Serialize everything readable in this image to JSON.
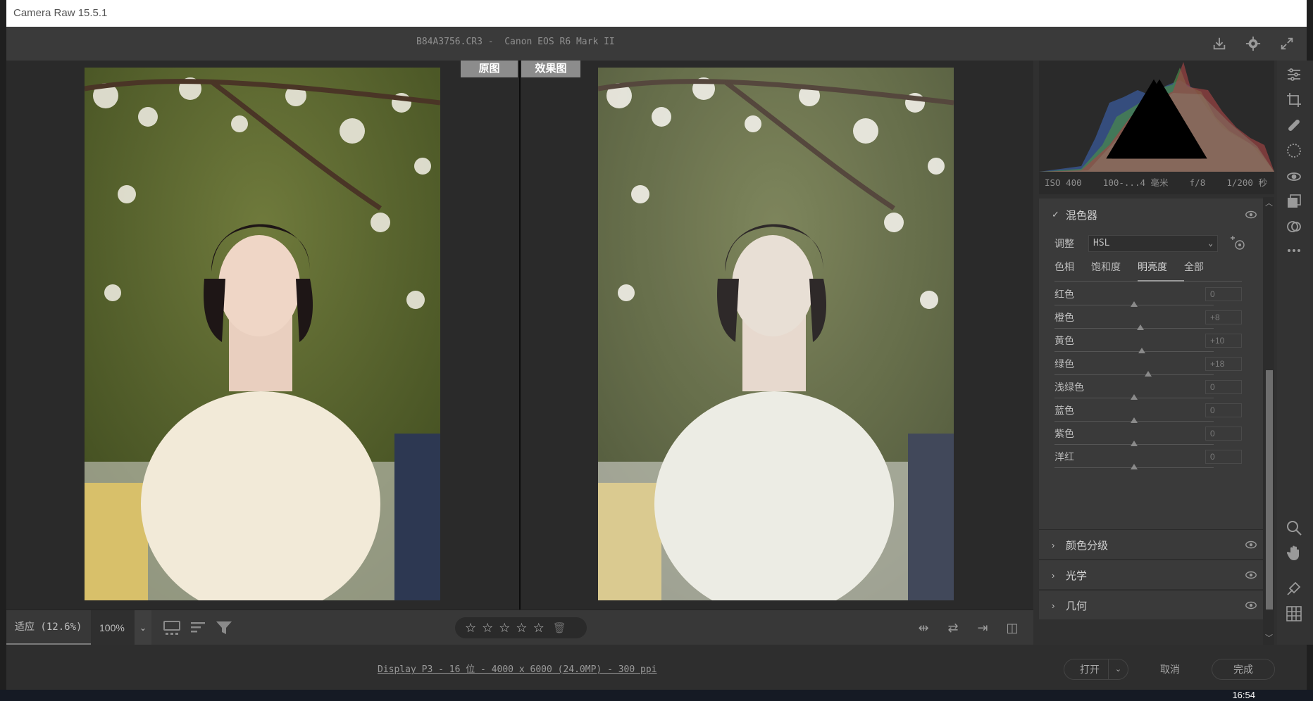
{
  "window": {
    "title": "Camera Raw 15.5.1"
  },
  "header": {
    "file_info": "B84A3756.CR3 -  Canon EOS R6 Mark II",
    "icons": [
      "save-icon",
      "settings-gear-icon",
      "fullscreen-icon"
    ]
  },
  "viewer": {
    "before_label": "原图",
    "after_label": "效果图"
  },
  "bottombar": {
    "fit_label": "适应 (12.6%)",
    "zoom_label": "100%",
    "stars": [
      "☆",
      "☆",
      "☆",
      "☆",
      "☆"
    ],
    "rating": 0
  },
  "histogram": {
    "exif": {
      "iso": "ISO 400",
      "lens": "100-...4 毫米",
      "aperture": "f/8",
      "shutter": "1/200 秒"
    }
  },
  "mixer": {
    "title": "混色器",
    "adjust_label": "调整",
    "adjust_value": "HSL",
    "tabs": [
      "色相",
      "饱和度",
      "明亮度",
      "全部"
    ],
    "active_tab": "明亮度",
    "sliders": [
      {
        "label": "红色",
        "value": "0",
        "level": 0.5
      },
      {
        "label": "橙色",
        "value": "+8",
        "level": 0.54
      },
      {
        "label": "黄色",
        "value": "+10",
        "level": 0.55
      },
      {
        "label": "绿色",
        "value": "+18",
        "level": 0.59
      },
      {
        "label": "浅绿色",
        "value": "0",
        "level": 0.5
      },
      {
        "label": "蓝色",
        "value": "0",
        "level": 0.5
      },
      {
        "label": "紫色",
        "value": "0",
        "level": 0.5
      },
      {
        "label": "洋红",
        "value": "0",
        "level": 0.5
      }
    ]
  },
  "sections": [
    {
      "title": "颜色分级"
    },
    {
      "title": "光学"
    },
    {
      "title": "几何"
    }
  ],
  "footer": {
    "info": "Display P3 - 16 位 - 4000 x 6000 (24.0MP) - 300 ppi",
    "open_label": "打开",
    "cancel_label": "取消",
    "done_label": "完成"
  },
  "taskbar": {
    "clock": "16:54"
  }
}
